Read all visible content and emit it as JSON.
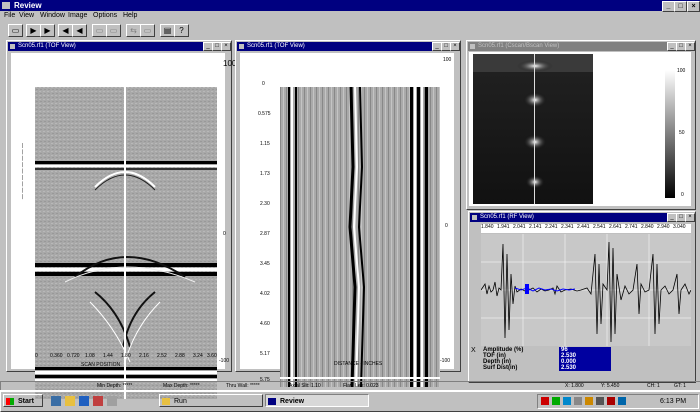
{
  "app": {
    "title": "Review"
  },
  "menu": [
    "File",
    "View",
    "Window",
    "Image",
    "Options",
    "Help"
  ],
  "panels": {
    "tof1": {
      "title": "Scn05.rf1 (TOF View)",
      "axis_label": "SCAN POSITION",
      "x_ticks": [
        "0",
        "0.360",
        "0.720",
        "1.08",
        "1.44",
        "1.80",
        "2.16",
        "2.52",
        "2.88",
        "3.24",
        "3.60"
      ],
      "right_ticks": [
        "100",
        "0",
        "-100"
      ]
    },
    "tof2": {
      "title": "Scn05.rf1 (TOF View)",
      "axis_label": "DISTANCE - INCHES",
      "y_ticks": [
        "0",
        "0.575",
        "1.15",
        "1.73",
        "2.30",
        "2.87",
        "3.45",
        "4.02",
        "4.60",
        "5.17",
        "5.75"
      ],
      "right_ticks": [
        "100",
        "0",
        "-100"
      ]
    },
    "cscan": {
      "title": "Scn05.rf1 (Cscan/Bscan View)",
      "scale_ticks": [
        "100",
        "50",
        "0"
      ]
    },
    "rf": {
      "title": "Scn05.rf1 (RF View)",
      "ruler": [
        "1.840",
        "1.941",
        "2.041",
        "2.141",
        "2.241",
        "2.341",
        "2.441",
        "2.541",
        "2.641",
        "2.741",
        "2.840",
        "2.940",
        "3.040"
      ],
      "readouts": [
        {
          "label": "Amplitude (%)",
          "value": "96"
        },
        {
          "label": "TOF (in)",
          "value": "2.530"
        },
        {
          "label": "Depth (in)",
          "value": "0.000"
        },
        {
          "label": "Surf Dist(in)",
          "value": "2.530"
        }
      ],
      "close_marker": "X"
    }
  },
  "status": {
    "min_depth": "Min Depth: *****",
    "max_depth": "Max Depth: *****",
    "thru_wall": "Thru Wall: *****",
    "axial_slit": "Axial Slit: 1.10",
    "flaw_len": "Flaw Len: 0.023",
    "x": "X: 1.800",
    "y": "Y: 5.450",
    "ch": "CH: 1",
    "gt": "GT: 1"
  },
  "taskbar": {
    "start": "Start",
    "tasks": [
      "Run",
      "Review"
    ],
    "clock": "6:13 PM"
  }
}
